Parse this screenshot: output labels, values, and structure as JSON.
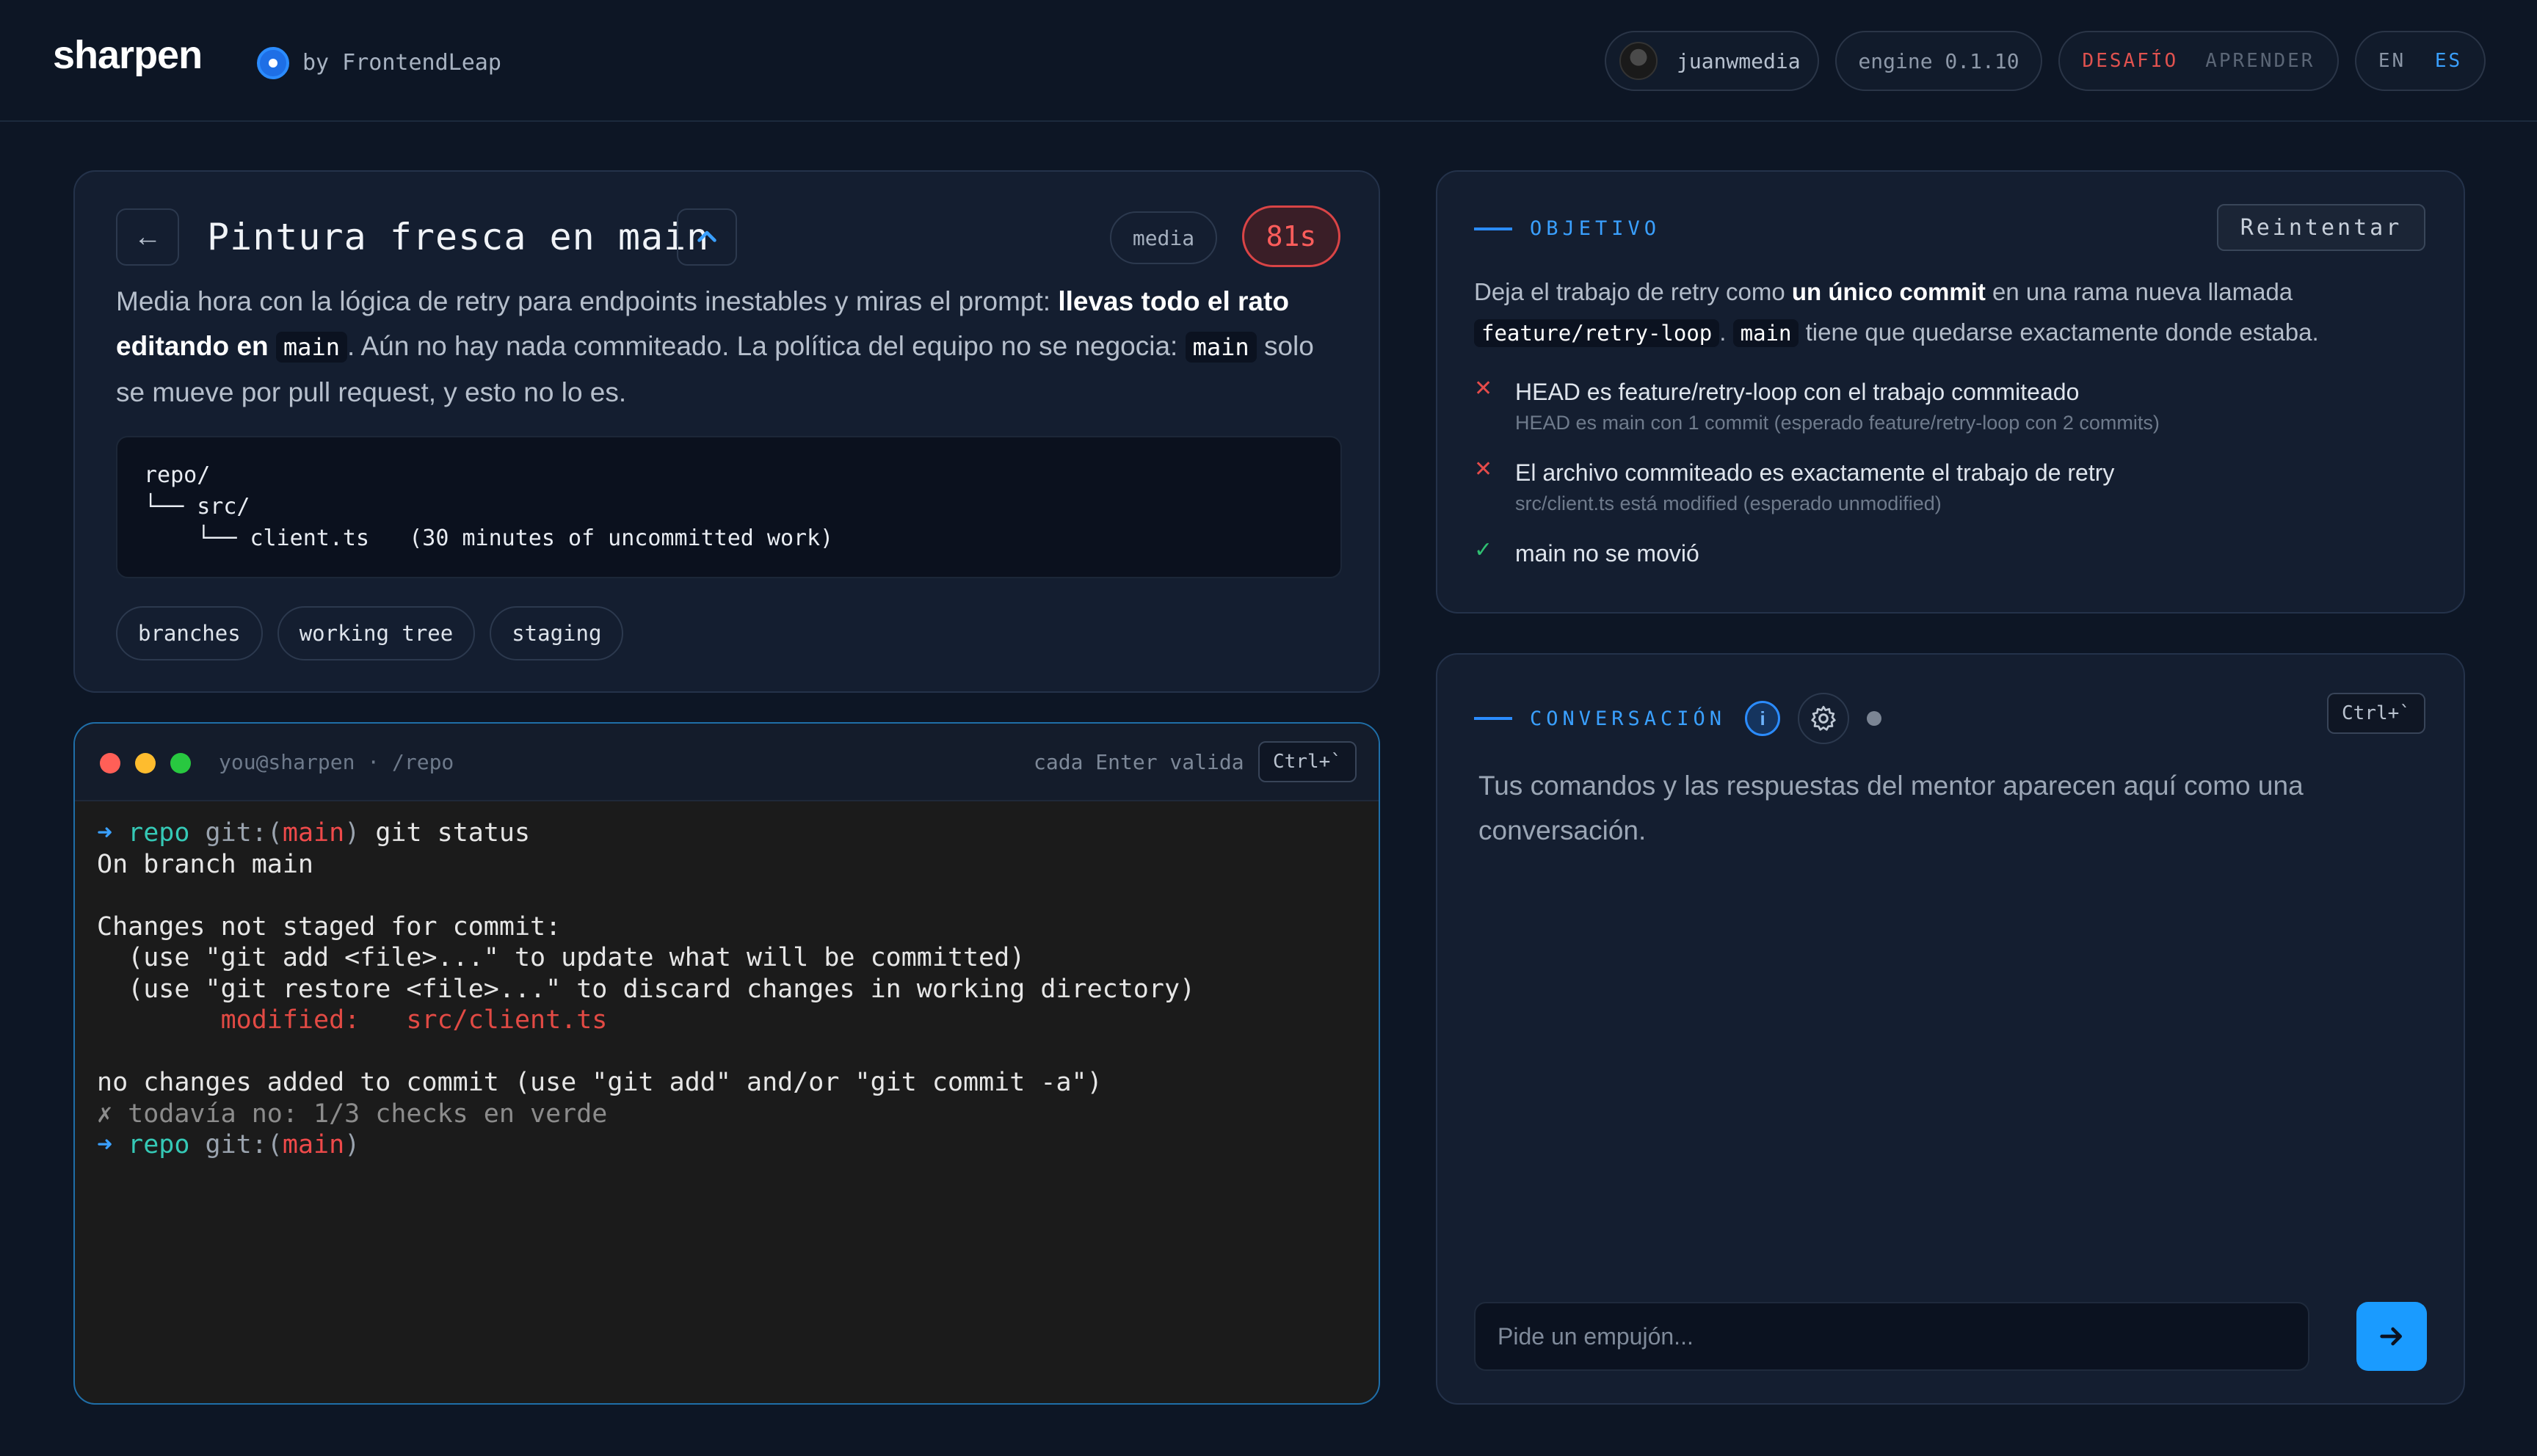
{
  "header": {
    "brand": "sharpen",
    "byline": "by FrontendLeap",
    "user": "juanwmedia",
    "engine": "engine 0.1.10",
    "modes": [
      "DESAFÍO",
      "APRENDER"
    ],
    "active_mode": "DESAFÍO",
    "langs": [
      "EN",
      "ES"
    ],
    "active_lang": "ES"
  },
  "challenge": {
    "title": "Pintura fresca en main",
    "level": "media",
    "timer": "81s",
    "desc": {
      "p1": "Media hora con la lógica de retry para endpoints inestables y miras el prompt: ",
      "b1": "llevas todo el rato editando en",
      "code1": "main",
      "p2": ". Aún no hay nada commiteado. La política del equipo no se negocia: ",
      "code2": "main",
      "p3": " solo se mueve por pull request, y esto no lo es."
    },
    "tree": "repo/\n└── src/\n    └── client.ts   (30 minutes of uncommitted work)",
    "tags": [
      "branches",
      "working tree",
      "staging"
    ]
  },
  "terminal": {
    "path": "you@sharpen · /repo",
    "hint": "cada Enter valida",
    "shortcut": "Ctrl+`",
    "prompt_arrow": "➜",
    "prompt_repo": "repo",
    "prompt_git": "git:(",
    "prompt_branch": "main",
    "prompt_close": ")",
    "command": " git status",
    "out1": "On branch main",
    "out2": "Changes not staged for commit:",
    "out3": "  (use \"git add <file>...\" to update what will be committed)",
    "out4": "  (use \"git restore <file>...\" to discard changes in working directory)",
    "mod_label": "        modified:   ",
    "mod_file": "src/client.ts",
    "out5": "no changes added to commit (use \"git add\" and/or \"git commit -a\")",
    "status_line": "✗ todavía no: 1/3 checks en verde"
  },
  "goal": {
    "label": "OBJETIVO",
    "retry": "Reintentar",
    "text": {
      "p1": "Deja el trabajo de retry como ",
      "b1": "un único commit",
      "p2": " en una rama nueva llamada ",
      "code1": "feature/retry-loop",
      "p3": ". ",
      "code2": "main",
      "p4": " tiene que quedarse exactamente donde estaba."
    },
    "checks": [
      {
        "status": "fail",
        "mark": "✕",
        "title": "HEAD es feature/retry-loop con el trabajo commiteado",
        "detail": "HEAD es main con 1 commit (esperado feature/retry-loop con 2 commits)"
      },
      {
        "status": "fail",
        "mark": "✕",
        "title": "El archivo commiteado es exactamente el trabajo de retry",
        "detail": "src/client.ts está modified (esperado unmodified)"
      },
      {
        "status": "pass",
        "mark": "✓",
        "title": "main no se movió",
        "detail": ""
      }
    ]
  },
  "chat": {
    "label": "CONVERSACIÓN",
    "info": "i",
    "shortcut": "Ctrl+`",
    "empty": "Tus comandos y las respuestas del mentor aparecen aquí como una conversación.",
    "placeholder": "Pide un empujón..."
  },
  "colors": {
    "accent": "#2b8cff",
    "danger": "#e44b4a",
    "success": "#2fbf71",
    "background": "#0d1625"
  }
}
